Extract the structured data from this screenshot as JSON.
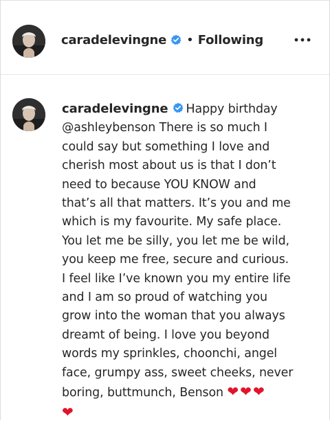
{
  "post": {
    "username": "caradelevingne",
    "separator": "•",
    "follow_status": "Following",
    "more_label": "•••"
  },
  "caption": {
    "username": "caradelevingne",
    "lines": [
      "Happy birthday",
      "@ashleybenson There is so much I",
      "could say but something I love and",
      "cherish most about us is that I don’t",
      "need to because YOU KNOW and",
      "that’s all that matters. It’s you and me",
      "which is my favourite. My safe place.",
      "You let me be silly, you let me be wild,",
      "you keep me free, secure and curious.",
      "I feel like I’ve known you my entire life",
      "and I am so proud of watching you",
      "grow into the woman that you always",
      "dreamt of being. I love you beyond",
      "words my sprinkles, choonchi, angel",
      "face, grumpy ass, sweet cheeks, never",
      "boring, buttmunch, Benson"
    ],
    "emoji_inline": "❤❤❤",
    "emoji_last": "❤"
  },
  "icons": {
    "verified": "verified-badge-icon",
    "more": "more-options-icon"
  },
  "colors": {
    "verified_blue": "#3897f0",
    "heart_red": "#e0142a",
    "text": "#262626"
  }
}
